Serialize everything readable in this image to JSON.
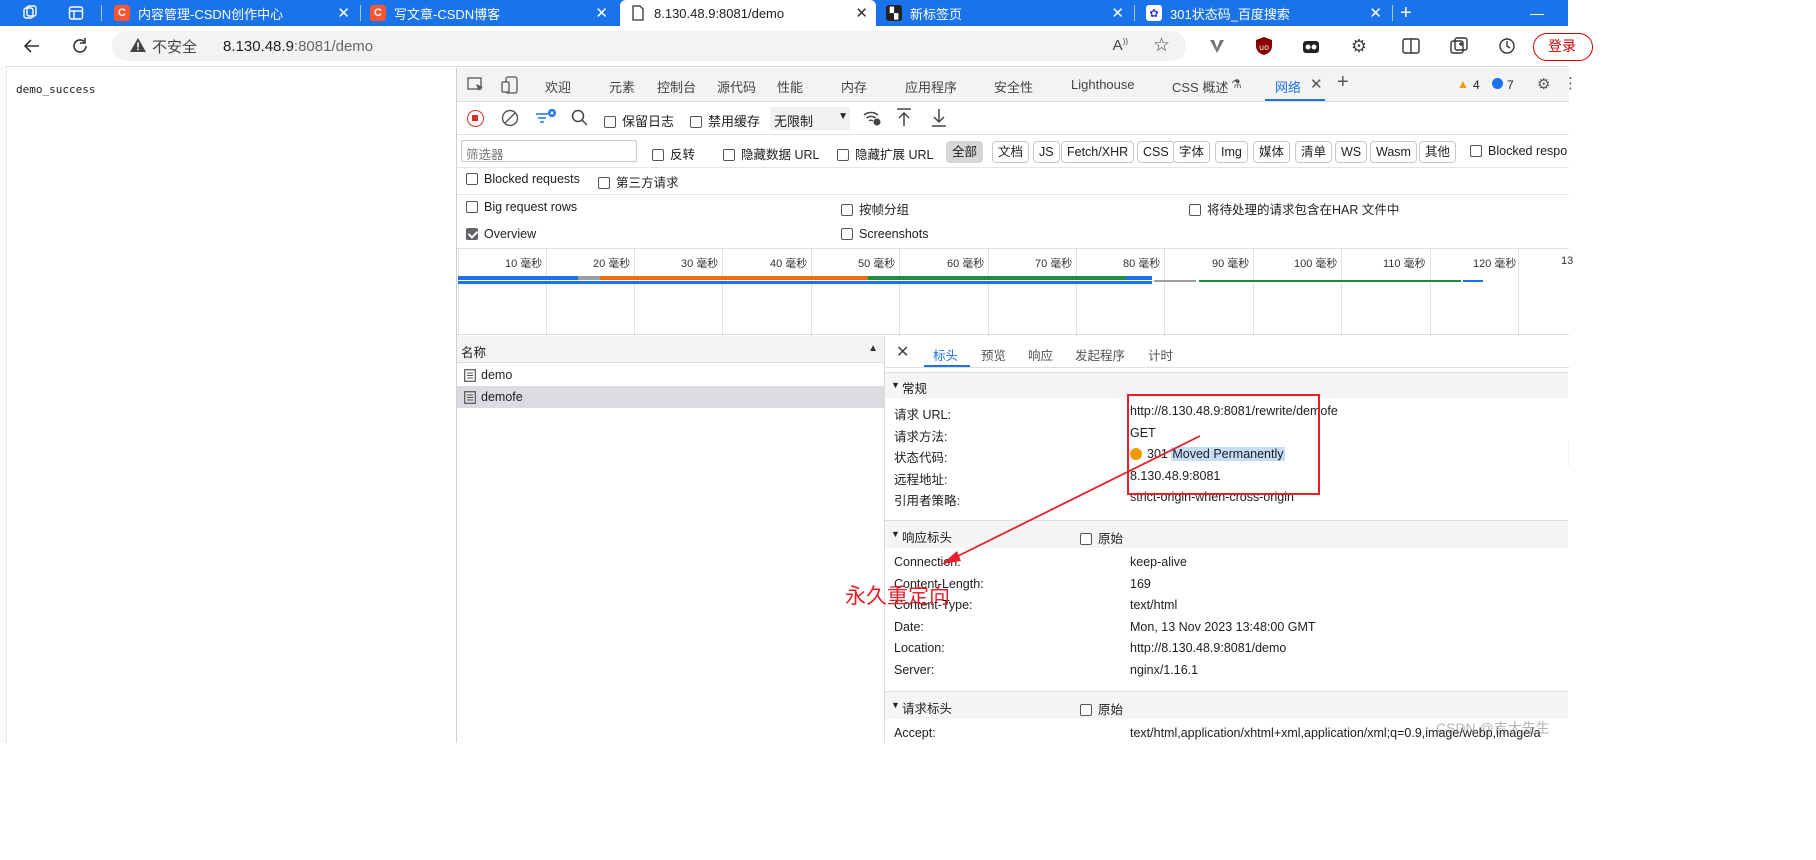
{
  "browser": {
    "tabs": [
      {
        "title": "内容管理-CSDN创作中心",
        "icon": "csdn-c-icon"
      },
      {
        "title": "写文章-CSDN博客",
        "icon": "csdn-c-icon"
      },
      {
        "title": "8.130.48.9:8081/demo",
        "icon": "page-icon"
      },
      {
        "title": "新标签页",
        "icon": "newtab-icon"
      },
      {
        "title": "301状态码_百度搜索",
        "icon": "baidu-icon"
      }
    ],
    "security_label": "不安全",
    "url_host": "8.130.48.9",
    "url_rest": ":8081/demo",
    "login_label": "登录"
  },
  "page": {
    "content": "demo_success"
  },
  "devtools": {
    "tabs": [
      "欢迎",
      "元素",
      "控制台",
      "源代码",
      "性能",
      "内存",
      "应用程序",
      "安全性",
      "Lighthouse",
      "CSS 概述",
      "网络"
    ],
    "warnings": "4",
    "messages": "7",
    "toolbar": {
      "preserve_log": "保留日志",
      "disable_cache": "禁用缓存",
      "throttle": "无限制"
    },
    "filter": {
      "placeholder": "筛选器",
      "invert": "反转",
      "hide_data_urls": "隐藏数据 URL",
      "hide_ext_urls": "隐藏扩展 URL",
      "types": [
        "全部",
        "文档",
        "JS",
        "Fetch/XHR",
        "CSS",
        "字体",
        "Img",
        "媒体",
        "清单",
        "WS",
        "Wasm",
        "其他"
      ],
      "blocked_resp": "Blocked respo"
    },
    "options": {
      "blocked_requests": "Blocked requests",
      "third_party": "第三方请求",
      "big_rows": "Big request rows",
      "group_by_frame": "按帧分组",
      "har_pending": "将待处理的请求包含在HAR 文件中",
      "overview": "Overview",
      "screenshots": "Screenshots"
    },
    "timeline_ticks": [
      "10 毫秒",
      "20 毫秒",
      "30 毫秒",
      "40 毫秒",
      "50 毫秒",
      "60 毫秒",
      "70 毫秒",
      "80 毫秒",
      "90 毫秒",
      "100 毫秒",
      "110 毫秒",
      "120 毫秒",
      "13"
    ],
    "requests": {
      "header": "名称",
      "items": [
        "demo",
        "demofe"
      ],
      "selected_index": 1
    },
    "detail_tabs": [
      "标头",
      "预览",
      "响应",
      "发起程序",
      "计时"
    ],
    "general": {
      "title": "常规",
      "rows": [
        {
          "key": "请求 URL:",
          "value": "http://8.130.48.9:8081/rewrite/demofe"
        },
        {
          "key": "请求方法:",
          "value": "GET"
        },
        {
          "key": "状态代码:",
          "value_code": "301",
          "value_text": "Moved Permanently"
        },
        {
          "key": "远程地址:",
          "value": "8.130.48.9:8081"
        },
        {
          "key": "引用者策略:",
          "value": "strict-origin-when-cross-origin"
        }
      ]
    },
    "response_headers": {
      "title": "响应标头",
      "raw": "原始",
      "rows": [
        {
          "key": "Connection:",
          "value": "keep-alive"
        },
        {
          "key": "Content-Length:",
          "value": "169"
        },
        {
          "key": "Content-Type:",
          "value": "text/html"
        },
        {
          "key": "Date:",
          "value": "Mon, 13 Nov 2023 13:48:00 GMT"
        },
        {
          "key": "Location:",
          "value": "http://8.130.48.9:8081/demo"
        },
        {
          "key": "Server:",
          "value": "nginx/1.16.1"
        }
      ]
    },
    "request_headers": {
      "title": "请求标头",
      "raw": "原始",
      "rows": [
        {
          "key": "Accept:",
          "value": "text/html,application/xhtml+xml,application/xml;q=0.9,image/webp,image/a"
        }
      ]
    }
  },
  "annotation": {
    "text": "永久重定向",
    "color": "#e8202a"
  },
  "watermark": "CSDN @吉大先生"
}
